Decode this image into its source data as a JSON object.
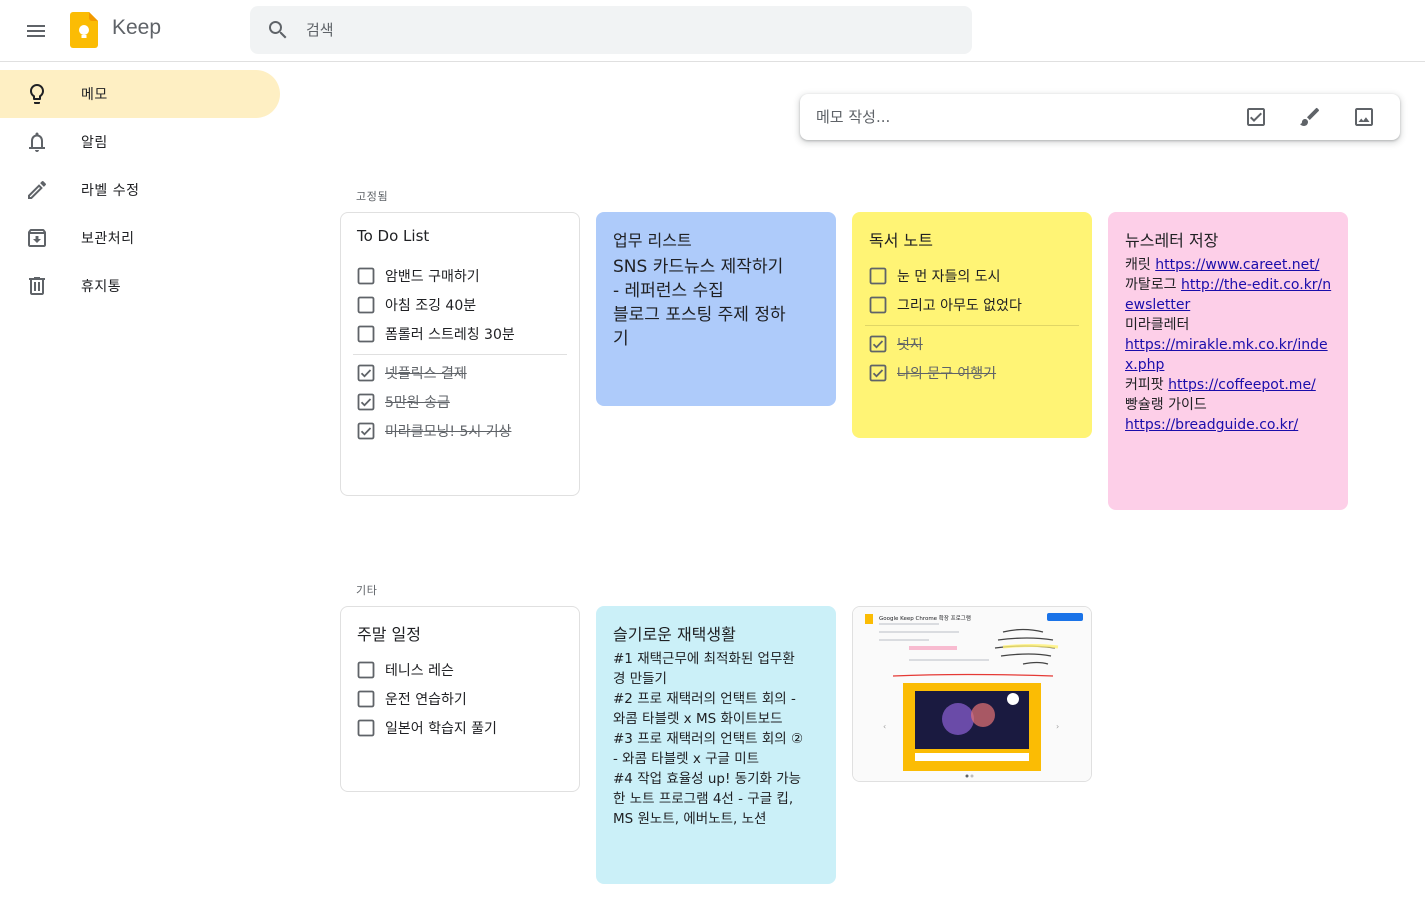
{
  "header": {
    "app_name": "Keep",
    "search_placeholder": "검색"
  },
  "sidebar": {
    "items": [
      {
        "label": "메모",
        "icon": "lightbulb-icon",
        "active": true
      },
      {
        "label": "알림",
        "icon": "bell-icon"
      },
      {
        "label": "라벨 수정",
        "icon": "pencil-icon"
      },
      {
        "label": "보관처리",
        "icon": "archive-icon"
      },
      {
        "label": "휴지통",
        "icon": "trash-icon"
      }
    ]
  },
  "take_note": {
    "placeholder": "메모 작성..."
  },
  "sections": {
    "pinned": "고정됨",
    "others": "기타"
  },
  "notes": {
    "todo": {
      "title": "To Do List",
      "unchecked": [
        "암밴드 구매하기",
        "아침 조깅 40분",
        "폼롤러 스트레칭 30분"
      ],
      "checked": [
        "넷플릭스 결제",
        "5만원 송금",
        "미라클모닝! 5시 기상"
      ]
    },
    "work": {
      "title": "업무 리스트",
      "lines": [
        "SNS 카드뉴스 제작하기",
        "- 레퍼런스 수집",
        "블로그 포스팅 주제 정하",
        "기"
      ],
      "color": "#aecbfa"
    },
    "reading": {
      "title": "독서 노트",
      "unchecked": [
        "눈 먼 자들의 도시",
        "그리고 아무도 없었다"
      ],
      "checked": [
        "넛지",
        "나의 문구 여행기"
      ],
      "color": "#fff475"
    },
    "newsletter": {
      "title": "뉴스레터 저장",
      "lines": [
        {
          "prefix": "캐릿 ",
          "link": "https://www.careet.net/"
        },
        {
          "prefix": "까탈로그 ",
          "link": "http://the-edit.co.kr/newsletter"
        },
        {
          "prefix": "미라클레터",
          "link": ""
        },
        {
          "prefix": "",
          "link": "https://mirakle.mk.co.kr/index.php"
        },
        {
          "prefix": "커피팟 ",
          "link": "https://coffeepot.me/"
        },
        {
          "prefix": "빵슐랭 가이드",
          "link": ""
        },
        {
          "prefix": "",
          "link": "https://breadguide.co.kr/"
        }
      ],
      "color": "#fdcfe8"
    },
    "weekend": {
      "title": "주말 일정",
      "unchecked": [
        "테니스 레슨",
        "운전 연습하기",
        "일본어 학습지 풀기"
      ]
    },
    "wfh": {
      "title": "슬기로운 재택생활",
      "lines": [
        "#1 재택근무에 최적화된 업무환",
        "경 만들기",
        "#2 프로 재택러의 언택트 회의 -",
        "와콤 타블렛 x MS 화이트보드",
        "#3 프로 재택러의 언택트 회의 ②",
        "- 와콤 타블렛 x 구글 미트",
        "#4 작업 효율성 up! 동기화 가능",
        "한 노트 프로그램 4선 - 구글 킵,",
        "MS 원노트, 에버노트, 노션"
      ],
      "color": "#cbf0f8"
    },
    "image_note": {
      "caption": "Google Keep Chrome 확장 프로그램"
    }
  },
  "colors": {
    "active_nav": "#feefc3",
    "keep_yellow": "#fbbc04"
  }
}
